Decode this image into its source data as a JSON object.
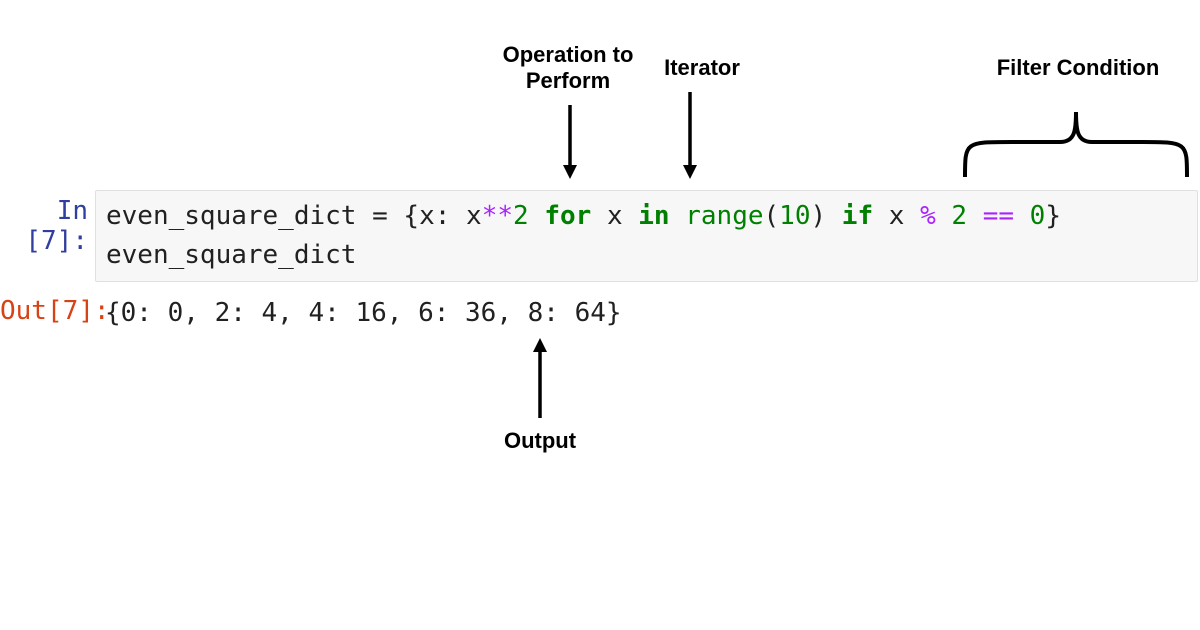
{
  "annotations": {
    "operation": "Operation to\nPerform",
    "iterator": "Iterator",
    "filter": "Filter Condition",
    "output": "Output"
  },
  "prompt": {
    "in_label": "In [7]:",
    "out_label": "Out[7]:"
  },
  "code": {
    "var1": "even_square_dict",
    "eq": " = ",
    "lbrace": "{",
    "key": "x",
    "colon": ": ",
    "xvar": "x",
    "pow": "**",
    "two": "2",
    "sp1": " ",
    "for_kw": "for",
    "sp2": " ",
    "loopvar": "x",
    "sp3": " ",
    "in_kw": "in",
    "sp4": " ",
    "range": "range",
    "lparen": "(",
    "ten": "10",
    "rparen": ")",
    "sp5": " ",
    "if_kw": "if",
    "sp6": " ",
    "x2": "x",
    "sp7": " ",
    "mod": "%",
    "sp8": " ",
    "two2": "2",
    "sp9": " ",
    "eqeq": "==",
    "sp10": " ",
    "zero": "0",
    "rbrace": "}",
    "line2": "even_square_dict"
  },
  "output": "{0: 0, 2: 4, 4: 16, 6: 36, 8: 64}"
}
